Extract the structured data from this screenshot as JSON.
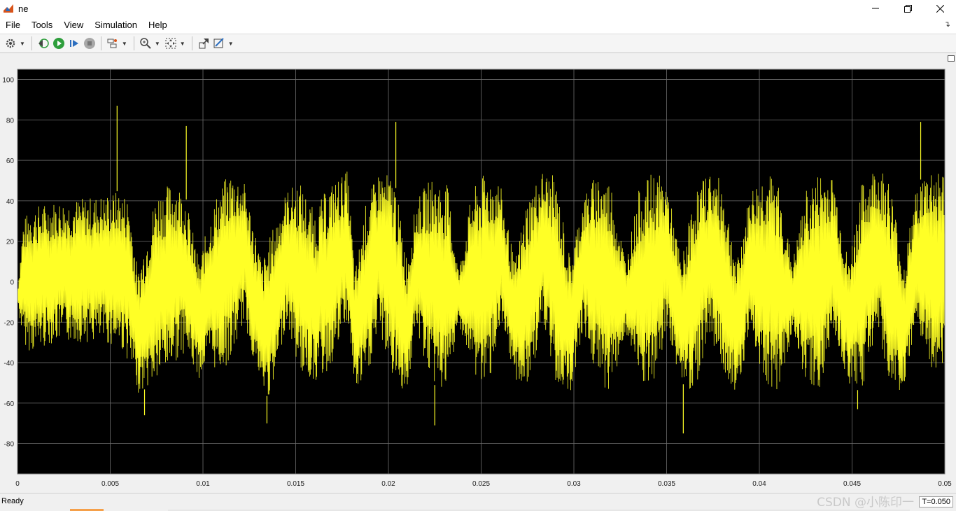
{
  "window": {
    "title": "ne",
    "icons": {
      "app": "matlab-icon",
      "minimize": "minimize-icon",
      "maximize": "restore-icon",
      "close": "close-icon"
    }
  },
  "menu": {
    "items": [
      {
        "label": "File"
      },
      {
        "label": "Tools"
      },
      {
        "label": "View"
      },
      {
        "label": "Simulation"
      },
      {
        "label": "Help"
      }
    ]
  },
  "toolbar": {
    "icons": [
      "settings-gear-icon",
      "step-back-icon",
      "run-icon",
      "step-forward-icon",
      "stop-icon",
      "signal-select-icon",
      "zoom-in-icon",
      "fit-to-view-icon",
      "highlight-block-icon",
      "style-icon"
    ]
  },
  "status": {
    "text": "Ready",
    "time": "T=0.050",
    "watermark": "CSDN @小陈印一"
  },
  "colors": {
    "plot_bg": "#000000",
    "trace": "#ffff26",
    "grid": "#6e6e6e",
    "stop_red": "#d9534f",
    "run_green": "#2e9e3c",
    "matlab_orange": "#d95319"
  },
  "chart_data": {
    "type": "line",
    "title": "",
    "xlabel": "",
    "ylabel": "",
    "xlim": [
      0,
      0.05
    ],
    "ylim": [
      -95,
      105
    ],
    "x_ticks": [
      0,
      0.005,
      0.01,
      0.015,
      0.02,
      0.025,
      0.03,
      0.035,
      0.04,
      0.045,
      0.05
    ],
    "x_tick_labels": [
      "0",
      "0.005",
      "0.01",
      "0.015",
      "0.02",
      "0.025",
      "0.03",
      "0.035",
      "0.04",
      "0.045",
      "0.05"
    ],
    "y_ticks": [
      -80,
      -60,
      -40,
      -20,
      0,
      20,
      40,
      60,
      80,
      100
    ],
    "y_tick_labels": [
      "-80",
      "-60",
      "-40",
      "-20",
      "0",
      "20",
      "40",
      "60",
      "80",
      "100"
    ],
    "grid": true,
    "legend": "none",
    "series": [
      {
        "color": "#ffff26",
        "envelope": {
          "x": [
            0,
            0.0003,
            0.0007,
            0.002,
            0.004,
            0.0055,
            0.006,
            0.0065,
            0.0075,
            0.0085,
            0.009,
            0.0098,
            0.0103,
            0.0108,
            0.0115,
            0.0122,
            0.0132,
            0.0137,
            0.0145,
            0.0152,
            0.016,
            0.0168,
            0.0178,
            0.0182,
            0.0188,
            0.0195,
            0.0203,
            0.021,
            0.0215,
            0.0223,
            0.0232,
            0.0238,
            0.0245,
            0.0253,
            0.026,
            0.0268,
            0.0275,
            0.0283,
            0.029,
            0.0298,
            0.0305,
            0.0313,
            0.032,
            0.0328,
            0.0335,
            0.0343,
            0.035,
            0.0358,
            0.0365,
            0.0373,
            0.038,
            0.0388,
            0.0395,
            0.0403,
            0.041,
            0.0418,
            0.0425,
            0.0433,
            0.044,
            0.0448,
            0.0455,
            0.0463,
            0.047,
            0.0478,
            0.0485,
            0.0493,
            0.05
          ],
          "max": [
            -5,
            30,
            37,
            40,
            42,
            45,
            42,
            5,
            45,
            50,
            45,
            10,
            30,
            45,
            55,
            50,
            10,
            25,
            45,
            50,
            35,
            48,
            55,
            5,
            40,
            55,
            52,
            12,
            40,
            52,
            48,
            5,
            45,
            55,
            50,
            10,
            42,
            55,
            52,
            12,
            42,
            55,
            50,
            10,
            45,
            55,
            50,
            10,
            45,
            55,
            50,
            10,
            45,
            55,
            50,
            10,
            45,
            55,
            52,
            10,
            48,
            58,
            52,
            10,
            48,
            58,
            55
          ],
          "min": [
            -10,
            -30,
            -35,
            -30,
            -30,
            -32,
            -40,
            -55,
            -50,
            -40,
            -35,
            -48,
            -40,
            -45,
            -40,
            -20,
            -55,
            -58,
            -20,
            -45,
            -50,
            -45,
            -20,
            -55,
            -50,
            -25,
            -50,
            -55,
            -25,
            -50,
            -55,
            -20,
            -45,
            -55,
            -25,
            -48,
            -55,
            -22,
            -50,
            -55,
            -25,
            -50,
            -55,
            -25,
            -50,
            -55,
            -25,
            -50,
            -55,
            -25,
            -45,
            -55,
            -25,
            -50,
            -55,
            -25,
            -50,
            -55,
            -25,
            -50,
            -55,
            -25,
            -50,
            -55,
            -25,
            -45,
            -40
          ]
        },
        "spikes": [
          {
            "x": 0.00537,
            "y": 87
          },
          {
            "x": 0.0091,
            "y": 77
          },
          {
            "x": 0.0204,
            "y": 79
          },
          {
            "x": 0.0487,
            "y": 79
          },
          {
            "x": 0.00685,
            "y": -66
          },
          {
            "x": 0.01345,
            "y": -70
          },
          {
            "x": 0.0225,
            "y": -71
          },
          {
            "x": 0.0359,
            "y": -75
          },
          {
            "x": 0.0453,
            "y": -63
          }
        ]
      }
    ]
  }
}
